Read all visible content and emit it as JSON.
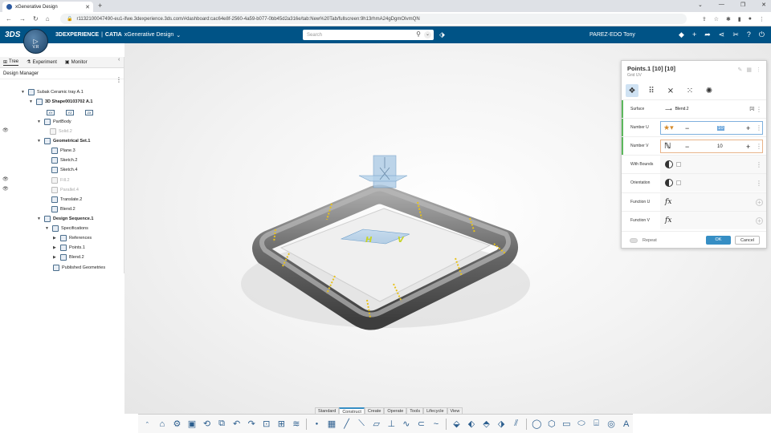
{
  "browser": {
    "tab_title": "xGenerative Design",
    "url": "r1132100047490-eu1-ifwe.3dexperience.3ds.com/#dashboard:cac64e8f-2560-4a59-b077-0bb45d2a316e/tab:New%20Tab/fullscreen:9h13rhmA24gDgmOIvmQN"
  },
  "header": {
    "logo": "3DS",
    "compass_version": "V.R",
    "brand": "3DEXPERIENCE",
    "separator": "|",
    "app": "CATIA",
    "product": "xGenerative Design",
    "search_placeholder": "Search",
    "user": "PAREZ-EDO Tony"
  },
  "tree": {
    "tabs": [
      "Tree",
      "Experiment",
      "Monitor"
    ],
    "manager_title": "Design Manager",
    "items": [
      {
        "label": "Subak Ceramic tray A.1"
      },
      {
        "label": "3D Shape00103702 A.1"
      },
      {
        "label": "PartBody"
      },
      {
        "label": "Solid.2"
      },
      {
        "label": "Geometrical Set.1"
      },
      {
        "label": "Plane.3"
      },
      {
        "label": "Sketch.2"
      },
      {
        "label": "Sketch.4"
      },
      {
        "label": "Fill.2"
      },
      {
        "label": "Parallel.4"
      },
      {
        "label": "Translate.2"
      },
      {
        "label": "Blend.2"
      },
      {
        "label": "Design Sequence.1"
      },
      {
        "label": "Specifications"
      },
      {
        "label": "References"
      },
      {
        "label": "Points.1"
      },
      {
        "label": "Blend.2"
      },
      {
        "label": "Published Geometries"
      }
    ],
    "chips": [
      "XY",
      "YZ",
      "ZX"
    ]
  },
  "panel": {
    "title": "Points.1 [10] [10]",
    "subtitle": "Grid UV",
    "rows": {
      "surface_label": "Surface",
      "surface_value": "Blend.2",
      "surface_count": "[1]",
      "number_u_label": "Number U",
      "number_u_value": "10",
      "number_v_label": "Number V",
      "number_v_value": "10",
      "with_bounds_label": "With Bounds",
      "orientation_label": "Orientation",
      "function_u_label": "Function U",
      "function_v_label": "Function V",
      "fx": "fx"
    },
    "repeat_label": "Repeat",
    "ok_label": "OK",
    "cancel_label": "Cancel"
  },
  "viewport": {
    "h_label": "H",
    "v_label": "V"
  },
  "action_bar": {
    "tabs": [
      "Standard",
      "Construct",
      "Create",
      "Operate",
      "Tools",
      "Lifecycle",
      "View"
    ],
    "active_tab": "Construct"
  },
  "colors": {
    "header_blue": "#005386",
    "accent_blue": "#368ec4",
    "marker_yellow": "#e8c21a",
    "tray_gray": "#6e6e6e"
  }
}
